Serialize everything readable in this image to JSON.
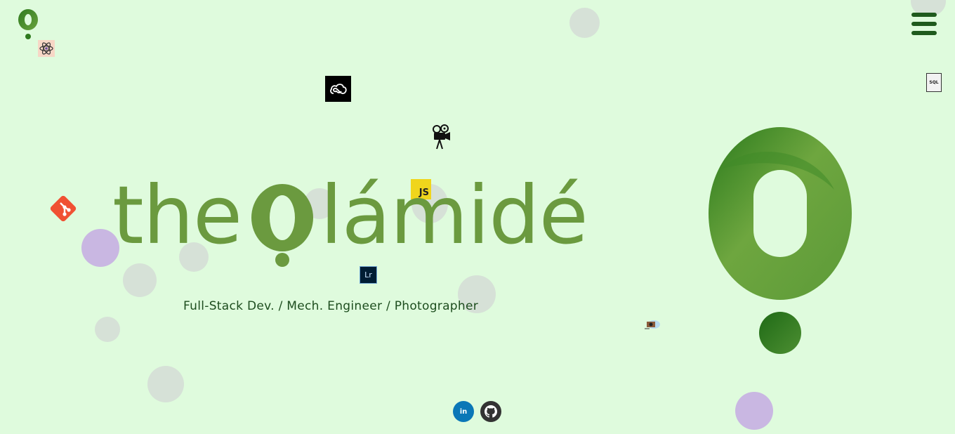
{
  "brand": {
    "prefix": "the",
    "suffix": "lámidé",
    "subtitle": "Full-Stack Dev. / Mech. Engineer / Photographer"
  },
  "header": {
    "logo": "olamide-logo-icon",
    "menu": "hamburger-menu-icon"
  },
  "tools": {
    "js_label": "JS",
    "lr_label": "Lr",
    "sql_label": "SQL",
    "icons": [
      "atom-icon",
      "creative-cloud-icon",
      "movie-camera-icon",
      "javascript-icon",
      "git-icon",
      "lightroom-icon",
      "sql-file-icon",
      "camera-icon"
    ]
  },
  "social": {
    "linkedin_label": "in",
    "icons": [
      "linkedin-icon",
      "github-icon"
    ]
  },
  "colors": {
    "background": "#dffbdd",
    "brand_green": "#6b9a3f",
    "dark_green": "#1f5a1d",
    "lilac": "#c9b7e2",
    "grey_bubble": "#d5dfd6",
    "linkedin_blue": "#0a77b7",
    "github_dark": "#333333",
    "git_orange": "#f05133"
  }
}
